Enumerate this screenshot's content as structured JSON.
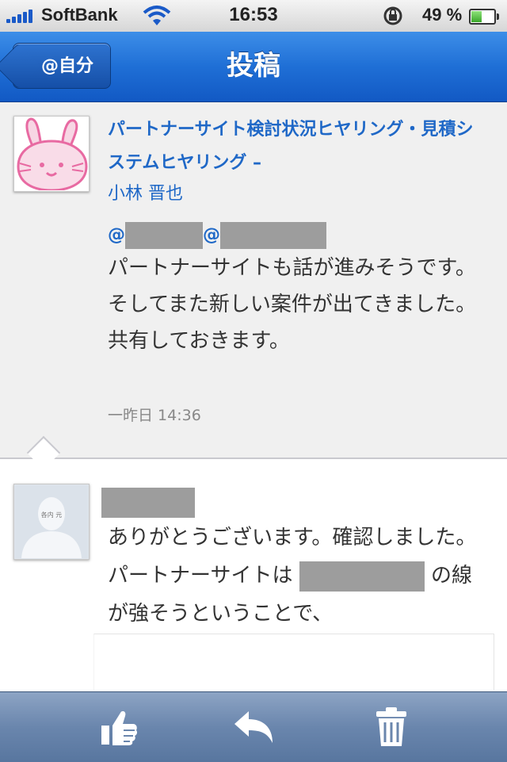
{
  "status_bar": {
    "carrier": "SoftBank",
    "time": "16:53",
    "battery_percent": "49 %",
    "battery_level": 0.49,
    "icons": [
      "signal-icon",
      "wifi-icon",
      "rotation-lock-icon",
      "battery-icon"
    ]
  },
  "nav": {
    "back_label": "@自分",
    "title": "投稿"
  },
  "post": {
    "title": "パートナーサイト検討状況ヒヤリング・見積システムヒヤリング –",
    "author": "小林 晋也",
    "mention_1": "@",
    "mention_2": "@",
    "body": "パートナーサイトも話が進みそうです。\nそしてまた新しい案件が出てきました。共有しておきます。",
    "timestamp": "一昨日 14:36",
    "avatar": "bunny-avatar-icon"
  },
  "reply": {
    "avatar": "person-avatar-icon",
    "avatar_caption": "各内 元",
    "body_part1": "ありがとうございます。確認しました。パートナーサイトは ",
    "body_part2": " の線が強そうということで、"
  },
  "toolbar": {
    "icons": [
      "like-icon",
      "reply-icon",
      "trash-icon"
    ]
  },
  "colors": {
    "nav_blue": "#1f6fd6",
    "link_blue": "#1f68c7",
    "toolbar": "#6a86ad",
    "redaction": "#9d9d9d"
  }
}
